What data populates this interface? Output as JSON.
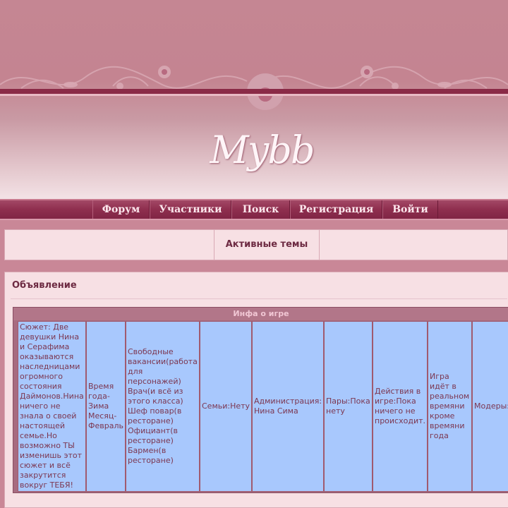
{
  "header": {
    "logo_text": "Mybb",
    "colors": {
      "stripe": "#8a2a47",
      "background": "#c58693"
    }
  },
  "nav": {
    "items": [
      {
        "label": "Форум"
      },
      {
        "label": "Участники"
      },
      {
        "label": "Поиск"
      },
      {
        "label": "Регистрация"
      },
      {
        "label": "Войти"
      }
    ]
  },
  "active_topics": {
    "label": "Активные темы"
  },
  "announcement": {
    "title": "Объявление",
    "table": {
      "header": "Инфа о игре",
      "cells": [
        "Сюжет: Две девушки Нина и Серафима оказываются наследницами огромного состояния Даймонов.Нина ничего не знала о своей настоящей семье.Но возможно ТЫ изменишь этот сюжет и всё закрутится вокруг ТЕБЯ!",
        "Время года-Зима Месяц-Февраль",
        "Свободные вакансии(работа для персонажей) Врач(и всё из этого класса) Шеф повар(в ресторане) Официант(в ресторане) Бармен(в ресторане)",
        "Семьи:Нету",
        "Администрация: Нина Сима",
        "Пары:Пока нету",
        "Действия в игре:Пока ничего не происходит.",
        "Игра идёт в реальном времяни кроме времяни года",
        "Модеры:"
      ]
    }
  }
}
